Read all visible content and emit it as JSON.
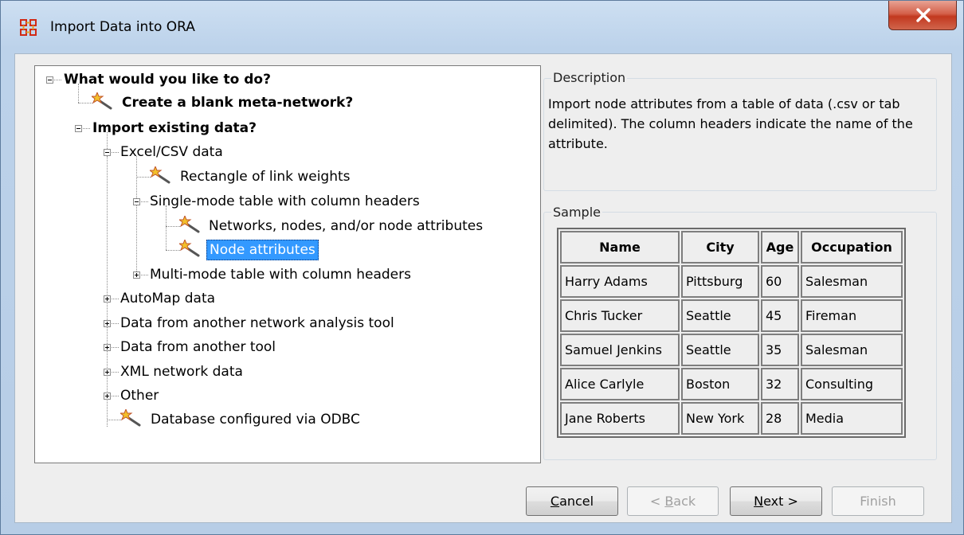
{
  "window": {
    "title": "Import Data into ORA",
    "close_glyph": "✕",
    "icon": "ora-app-icon",
    "close_color": "#c7402a"
  },
  "tree": {
    "root": "What would you like to do?",
    "blank": "Create a blank meta-network?",
    "import": "Import existing data?",
    "excel": "Excel/CSV data",
    "rect": "Rectangle of link weights",
    "single": "Single-mode table with column headers",
    "networks": "Networks, nodes, and/or node attributes",
    "nodeattr": "Node attributes",
    "multi": "Multi-mode table with column headers",
    "automap": "AutoMap data",
    "other_net": "Data from another network analysis tool",
    "other_tool": "Data from another tool",
    "xml": "XML network data",
    "other": "Other",
    "odbc": "Database configured via ODBC",
    "selected_color": "#3399ff",
    "leaf_icon": "wand-icon"
  },
  "description": {
    "label": "Description",
    "text": "Import node attributes from a table of data (.csv or tab delimited). The column headers indicate the name of the attribute."
  },
  "sample": {
    "label": "Sample",
    "headers": [
      "Name",
      "City",
      "Age",
      "Occupation"
    ],
    "rows": [
      [
        "Harry Adams",
        "Pittsburg",
        "60",
        "Salesman"
      ],
      [
        "Chris Tucker",
        "Seattle",
        "45",
        "Fireman"
      ],
      [
        "Samuel Jenkins",
        "Seattle",
        "35",
        "Salesman"
      ],
      [
        "Alice Carlyle",
        "Boston",
        "32",
        "Consulting"
      ],
      [
        "Jane Roberts",
        "New York",
        "28",
        "Media"
      ]
    ]
  },
  "buttons": {
    "cancel": {
      "mnemonic": "C",
      "rest": "ancel"
    },
    "back": {
      "pre": "< ",
      "mnemonic": "B",
      "rest": "ack"
    },
    "next": {
      "mnemonic": "N",
      "rest": "ext >"
    },
    "finish": "Finish"
  }
}
